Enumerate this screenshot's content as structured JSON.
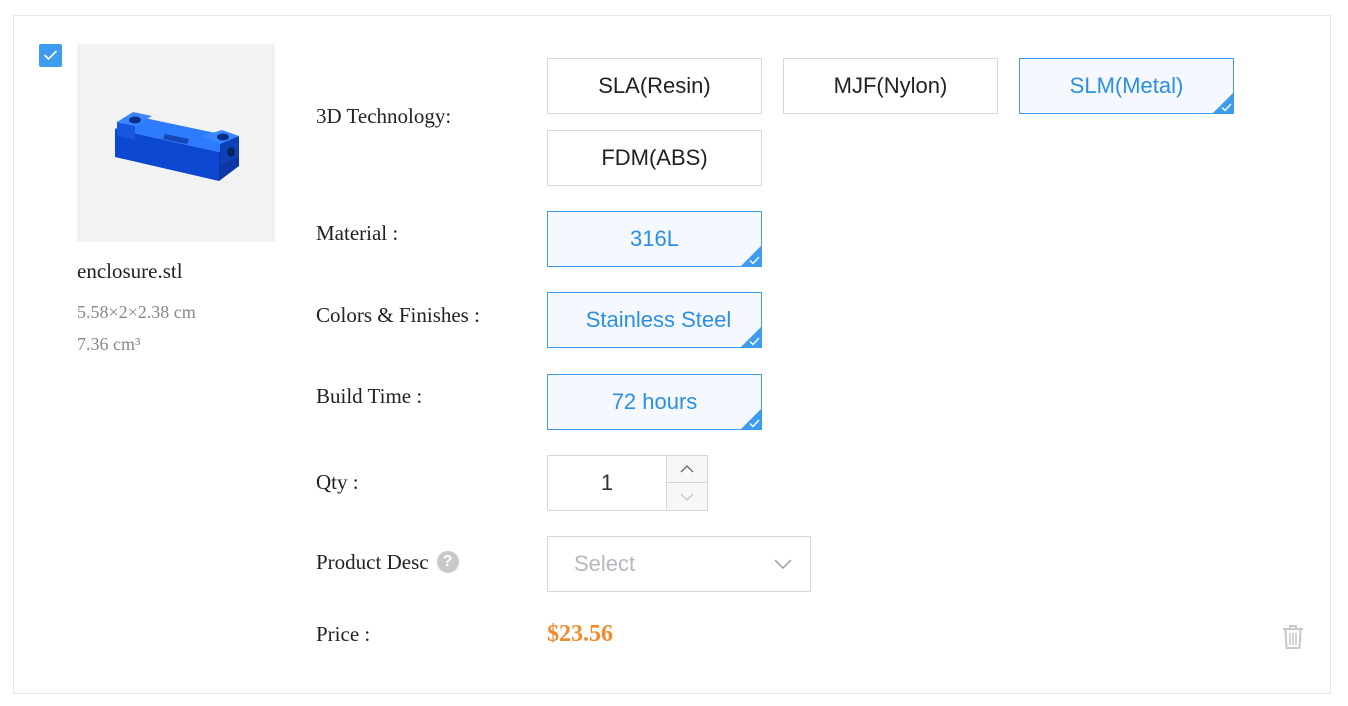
{
  "item": {
    "selected": true,
    "file_name": "enclosure.stl",
    "dimensions": "5.58×2×2.38 cm",
    "volume": "7.36 cm³"
  },
  "technology": {
    "label": "3D Technology:",
    "options": [
      "SLA(Resin)",
      "MJF(Nylon)",
      "SLM(Metal)",
      "FDM(ABS)"
    ],
    "selected": "SLM(Metal)"
  },
  "material": {
    "label": "Material :",
    "value": "316L"
  },
  "finish": {
    "label": "Colors & Finishes :",
    "value": "Stainless Steel"
  },
  "build_time": {
    "label": "Build Time :",
    "value": "72 hours"
  },
  "qty": {
    "label": "Qty :",
    "value": "1"
  },
  "product_desc": {
    "label": "Product Desc",
    "help_icon": "question-circle-icon",
    "placeholder": "Select"
  },
  "price": {
    "label": "Price :",
    "value": "$23.56"
  },
  "colors": {
    "accent": "#3d9cf0",
    "accent_text": "#2b8fe6",
    "price": "#f28a2e",
    "part": "#1a5ce8"
  },
  "icons": {
    "checkbox": "check-icon",
    "delete": "trash-icon",
    "dropdown": "chevron-down-icon",
    "qty_up": "chevron-up-icon",
    "qty_down": "chevron-down-icon"
  }
}
